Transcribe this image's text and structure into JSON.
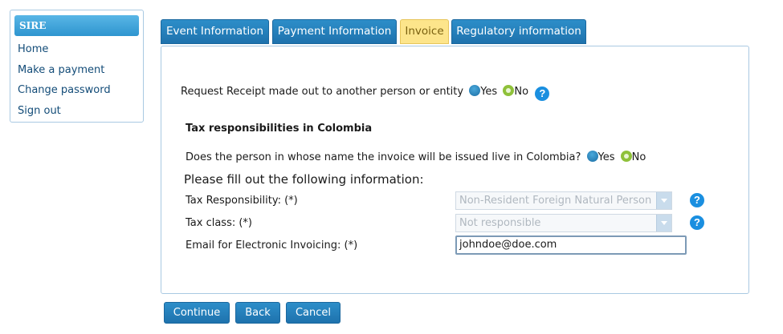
{
  "sidebar": {
    "title": "SIRE",
    "items": [
      {
        "label": "Home"
      },
      {
        "label": "Make a payment"
      },
      {
        "label": "Change password"
      },
      {
        "label": "Sign out"
      }
    ]
  },
  "tabs": [
    {
      "label": "Event Information",
      "active": false
    },
    {
      "label": "Payment Information",
      "active": false
    },
    {
      "label": "Invoice",
      "active": true
    },
    {
      "label": "Regulatory information",
      "active": false
    }
  ],
  "receipt": {
    "question": "Request Receipt made out to another person or entity",
    "yes_label": "Yes",
    "no_label": "No",
    "selected": "No",
    "help_icon": "?"
  },
  "tax": {
    "section_title": "Tax responsibilities in Colombia",
    "residency_question": "Does the person in whose name the invoice will be issued live in Colombia?",
    "yes_label": "Yes",
    "no_label": "No",
    "selected": "No",
    "fill_prompt": "Please fill out the following information:",
    "responsibility_label": "Tax Responsibility: (*)",
    "responsibility_value": "Non-Resident Foreign Natural Person",
    "class_label": "Tax class: (*)",
    "class_value": "Not responsible",
    "email_label": "Email for Electronic Invoicing: (*)",
    "email_value": "johndoe@doe.com",
    "help_icon": "?"
  },
  "buttons": {
    "continue": "Continue",
    "back": "Back",
    "cancel": "Cancel"
  },
  "colors": {
    "accent": "#1e72ad",
    "active_tab": "#fde58b",
    "selected_radio": "#8fc13a",
    "help": "#1a8fe0"
  }
}
